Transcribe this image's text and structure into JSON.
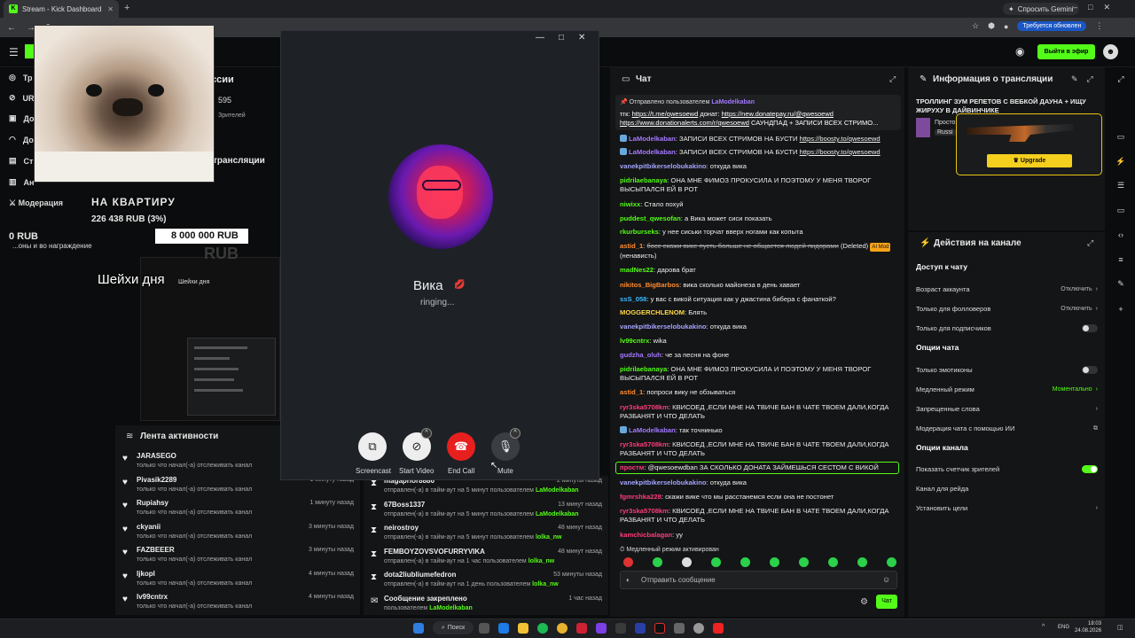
{
  "browser": {
    "tab_title": "Stream - Kick Dashboard",
    "gemini": "Спросить Gemini",
    "update": "Требуется обновлен"
  },
  "header": {
    "go_live": "Выйти в эфир"
  },
  "sidebar": {
    "items": [
      {
        "label": "Тр",
        "icon": "broadcast-icon"
      },
      {
        "label": "UR",
        "icon": "link-icon"
      },
      {
        "label": "До",
        "icon": "dashboard-icon"
      },
      {
        "label": "До",
        "icon": "wifi-icon"
      },
      {
        "label": "Ст",
        "icon": "stats-icon"
      },
      {
        "label": "Ан",
        "icon": "analytics-icon"
      }
    ],
    "moderation": "Модерация"
  },
  "stats": {
    "viewers": "595",
    "viewers_label": "Зрителей",
    "partial_header": "ссии",
    "partial_header2": "трансляции"
  },
  "overlay": {
    "goal_title": "НА КВАРТИРУ",
    "goal_amount": "226 438 RUB (3%)",
    "goal_start": "0 RUB",
    "goal_target": "8 000 000 RUB",
    "goal_ghost": "RUB",
    "rewards": "...оны и во награждение",
    "sheikhi": "Шейхи дня",
    "sheikhi_small": "Шейхи дня"
  },
  "call": {
    "name": "Вика",
    "emoji": "💋",
    "status": "ringing...",
    "buttons": [
      {
        "label": "Screencast",
        "icon": "screencast-icon"
      },
      {
        "label": "Start Video",
        "icon": "video-off-icon"
      },
      {
        "label": "End Call",
        "icon": "phone-hangup-icon"
      },
      {
        "label": "Mute",
        "icon": "mic-icon"
      }
    ]
  },
  "activity_feed": {
    "title": "Лента активности",
    "rows": [
      {
        "name": "JARASEGO",
        "desc": "только что начал(-а) отслеживать канал",
        "time": ""
      },
      {
        "name": "Pivasik2289",
        "desc": "только что начал(-а) отслеживать канал",
        "time": "1 минуту назад"
      },
      {
        "name": "Rupiahsy",
        "desc": "только что начал(-а) отслеживать канал",
        "time": "1 минуту назад"
      },
      {
        "name": "ckyanii",
        "desc": "только что начал(-а) отслеживать канал",
        "time": "3 минуты назад"
      },
      {
        "name": "FAZBEEER",
        "desc": "только что начал(-а) отслеживать канал",
        "time": "3 минуты назад"
      },
      {
        "name": "ljkopl",
        "desc": "только что начал(-а) отслеживать канал",
        "time": "4 минуты назад"
      },
      {
        "name": "lv99cntrx",
        "desc": "только что начал(-а) отслеживать канал",
        "time": "4 минуты назад"
      }
    ]
  },
  "mod_feed": {
    "rows": [
      {
        "name": "magaprior8886",
        "desc": "отправлен(-а) в тайм-аут на 5 минут пользователем",
        "by": "LaModelkaban",
        "time": "2 минуты назад"
      },
      {
        "name": "67Boss1337",
        "desc": "отправлен(-а) в тайм-аут на 5 минут пользователем",
        "by": "LaModelkaban",
        "time": "13 минут назад"
      },
      {
        "name": "neirostroy",
        "desc": "отправлен(-а) в тайм-аут на 5 минут пользователем",
        "by": "lolka_nw",
        "time": "48 минут назад"
      },
      {
        "name": "FEMBOYZOVSVOFURRYVIKA",
        "desc": "отправлен(-а) в тайм-аут на 1 час пользователем",
        "by": "lolka_nw",
        "time": "48 минут назад"
      },
      {
        "name": "dota2liubliumefedron",
        "desc": "отправлен(-а) в тайм-аут на 1 день пользователем",
        "by": "lolka_nw",
        "time": "53 минуты назад"
      },
      {
        "name": "Сообщение закреплено",
        "desc": "пользователем",
        "by": "LaModelkaban",
        "time": "1 час назад"
      }
    ]
  },
  "chat": {
    "title": "Чат",
    "pinned_by": "Отправлено пользователем",
    "pinned_user": "LaModelkaban",
    "pinned_line1_a": "тгк: ",
    "pinned_line1_link1": "https://t.me/qwesoewd",
    "pinned_line1_b": " донат: ",
    "pinned_line1_link2": "https://new.donatepay.ru/@qwesoewd",
    "pinned_line2_link": "https://www.donationalerts.com/r/qwesoewd",
    "pinned_line2_b": " САУНДПАД + ЗАПИСИ ВСЕХ СТРИМО...",
    "messages": [
      {
        "user": "LaModelkaban",
        "color": "#a378ff",
        "badge": true,
        "text": "ЗАПИСИ ВСЕХ СТРИМОВ НА БУСТИ ",
        "link": "https://boosty.to/qwesoewd"
      },
      {
        "user": "LaModelkaban",
        "color": "#a378ff",
        "badge": true,
        "text": "ЗАПИСИ ВСЕХ СТРИМОВ НА БУСТИ ",
        "link": "https://boosty.to/qwesoewd"
      },
      {
        "user": "vanekpitbikerselobukakino",
        "color": "#a4a4ff",
        "text": "откуда вика"
      },
      {
        "user": "pidrilaebanaya",
        "color": "#53fc18",
        "text": "ОНА МНЕ ФИМОЗ ПРОКУСИЛА И ПОЭТОМУ У МЕНЯ ТВОРОГ ВЫСЫПАЛСЯ ЕЙ В РОТ"
      },
      {
        "user": "niwixx",
        "color": "#53fc18",
        "text": "Стало похуй"
      },
      {
        "user": "puddest_qwesofan",
        "color": "#53fc18",
        "text": "а Вика может сиси показать"
      },
      {
        "user": "rkurburseks",
        "color": "#53fc18",
        "text": "у нее сиськи торчат вверх ногами как копыта"
      },
      {
        "user": "astid_1",
        "color": "#ff8a30",
        "text": "босс скажи вике пусть больше не общается людей пидорами",
        "strike": true,
        "tail": "(Deleted)",
        "tag": "AI Mod",
        "tail2": "(ненависть)"
      },
      {
        "user": "madNes22",
        "color": "#53fc18",
        "text": "дарова брат"
      },
      {
        "user": "nikitos_BigBarbos",
        "color": "#ff8a30",
        "text": "вика сколько майонеза в день хавает"
      },
      {
        "user": "ssS_058",
        "color": "#3cb8ff",
        "text": "у вас с викой ситуация как у джастина бибера с фанаткой?"
      },
      {
        "user": "MOGGERCHLENOM",
        "color": "#ffd84a",
        "text": "Блять"
      },
      {
        "user": "vanekpitbikerselobukakino",
        "color": "#a4a4ff",
        "text": "откуда вика"
      },
      {
        "user": "lv99cntrx",
        "color": "#53fc18",
        "text": "wika"
      },
      {
        "user": "gudzha_oluh",
        "color": "#a378ff",
        "text": "че за песня на фоне"
      },
      {
        "user": "pidrilaebanaya",
        "color": "#53fc18",
        "text": "ОНА МНЕ ФИМОЗ ПРОКУСИЛА И ПОЭТОМУ У МЕНЯ ТВОРОГ ВЫСЫПАЛСЯ ЕЙ В РОТ"
      },
      {
        "user": "astid_1",
        "color": "#ff8a30",
        "text": "попроси вику не обзываться"
      },
      {
        "user": "ryr3ska5708km",
        "color": "#ff3b7a",
        "text": "КВИСОЕД ,ЕСЛИ МНЕ НА ТВИЧЕ БАН В ЧАТЕ ТВОЕМ ДАЛИ,КОГДА РАЗБАНЯТ И ЧТО ДЕЛАТЬ"
      },
      {
        "user": "LaModelkaban",
        "color": "#a378ff",
        "badge": true,
        "text": "так точнинько"
      },
      {
        "user": "ryr3ska5708km",
        "color": "#ff3b7a",
        "text": "КВИСОЕД ,ЕСЛИ МНЕ НА ТВИЧЕ БАН В ЧАТЕ ТВОЕМ ДАЛИ,КОГДА РАЗБАНЯТ И ЧТО ДЕЛАТЬ"
      },
      {
        "user": "простм",
        "color": "#ff3b7a",
        "text": "@qwesoewdban ЗА СКОЛЬКО ДОНАТА ЗАЙМЕШЬСЯ СЕСТОМ С ВИКОЙ",
        "highlight": true
      },
      {
        "user": "vanekpitbikerselobukakino",
        "color": "#a4a4ff",
        "text": "откуда вика"
      },
      {
        "user": "fgmrshka228",
        "color": "#ff3b7a",
        "text": "скажи вике что мы расстанемся если она не постонет"
      },
      {
        "user": "ryr3ska5708km",
        "color": "#ff3b7a",
        "text": "КВИСОЕД ,ЕСЛИ МНЕ НА ТВИЧЕ БАН В ЧАТЕ ТВОЕМ ДАЛИ,КОГДА РАЗБАНЯТ И ЧТО ДЕЛАТЬ"
      },
      {
        "user": "kamchicbalagan",
        "color": "#ff3b7a",
        "text": "уу"
      }
    ],
    "slow_mode": "Медленный режим активирован",
    "input_placeholder": "Отправить сообщение",
    "send": "Чат"
  },
  "stream_info": {
    "title": "Информация о трансляции",
    "stream_title": "ТРОЛЛИНГ ЗУМ РЕПЕТОВ С ВЕБКОЙ ДАУНА + ИЩУ ЖИРУХУ В ДАЙВИНЧИКЕ",
    "category": "Просто",
    "language": "Russi",
    "ad_button": "Upgrade"
  },
  "channel_actions": {
    "title": "Действия на канале",
    "sections": [
      {
        "title": "Доступ к чату",
        "options": [
          {
            "label": "Возраст аккаунта",
            "value": "Отключить",
            "kind": "select"
          },
          {
            "label": "Только для фолловеров",
            "value": "Отключить",
            "kind": "select"
          },
          {
            "label": "Только для подписчиков",
            "kind": "toggle",
            "on": false
          }
        ]
      },
      {
        "title": "Опции чата",
        "options": [
          {
            "label": "Только эмотиконы",
            "kind": "toggle",
            "on": false
          },
          {
            "label": "Медленный режим",
            "value": "Моментально",
            "kind": "select",
            "green": true
          },
          {
            "label": "Запрещенные слова",
            "kind": "link"
          },
          {
            "label": "Модерация чата с помощью ИИ",
            "kind": "external"
          }
        ]
      },
      {
        "title": "Опции канала",
        "options": [
          {
            "label": "Показать счетчик зрителей",
            "kind": "toggle",
            "on": true
          },
          {
            "label": "Канал для рейда",
            "kind": "plain"
          },
          {
            "label": "Установить цели",
            "kind": "link"
          }
        ]
      }
    ]
  },
  "taskbar": {
    "search": "Поиск",
    "lang": "ENG",
    "time": "18:03",
    "date": "24.08.2026"
  }
}
